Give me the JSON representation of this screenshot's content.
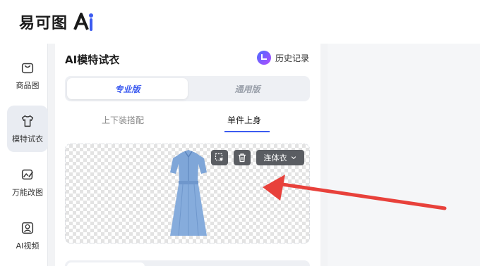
{
  "header": {
    "logo_text": "易可图",
    "logo_mark": "Ai"
  },
  "sidebar": {
    "items": [
      {
        "label": "商品图",
        "icon": "shopping-bag-icon",
        "active": false
      },
      {
        "label": "模特试衣",
        "icon": "tshirt-icon",
        "active": true
      },
      {
        "label": "万能改图",
        "icon": "edit-image-icon",
        "active": false
      },
      {
        "label": "AI视频",
        "icon": "video-icon",
        "active": false
      }
    ]
  },
  "panel": {
    "title": "AI模特试衣",
    "history_label": "历史记录",
    "modes": {
      "pro": "专业版",
      "general": "通用版"
    },
    "tabs": {
      "combo": "上下装搭配",
      "single": "单件上身"
    },
    "garment": {
      "category": "连体衣"
    }
  },
  "colors": {
    "accent": "#3c5bf0",
    "annotation_arrow": "#e8413b"
  }
}
